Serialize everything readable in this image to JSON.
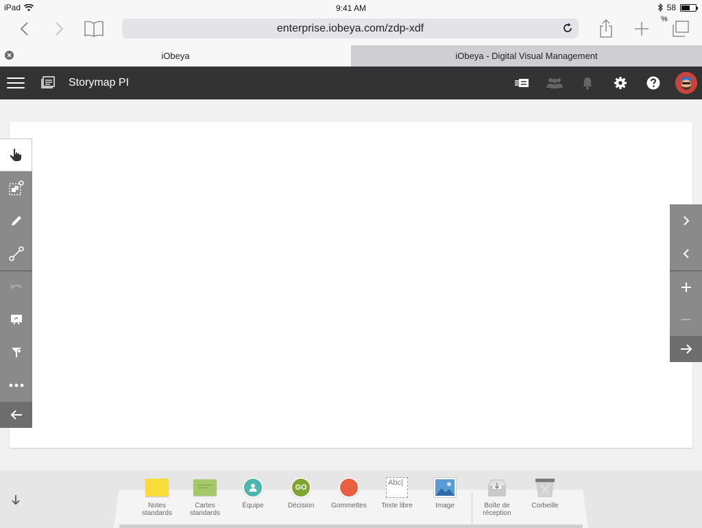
{
  "status_bar": {
    "device": "iPad",
    "time": "9:41 AM",
    "battery": "58",
    "battery_unit": "%",
    "battery_level": 0.58
  },
  "browser": {
    "url": "enterprise.iobeya.com/zdp-xdf"
  },
  "tabs": [
    {
      "label": "iObeya",
      "active": true
    },
    {
      "label": "iObeya - Digital Visual Management",
      "active": false
    }
  ],
  "app": {
    "room_title": "Storymap PI"
  },
  "palette": {
    "items": [
      {
        "label_line1": "Notes",
        "label_line2": "standards",
        "icon": "sticky-note-icon"
      },
      {
        "label_line1": "Cartes",
        "label_line2": "standards",
        "icon": "card-icon"
      },
      {
        "label_line1": "Équipe",
        "label_line2": "",
        "icon": "team-icon"
      },
      {
        "label_line1": "Décision",
        "label_line2": "",
        "icon": "decision-icon",
        "text": "GO"
      },
      {
        "label_line1": "Gommettes",
        "label_line2": "",
        "icon": "sticker-icon"
      },
      {
        "label_line1": "Texte libre",
        "label_line2": "",
        "icon": "free-text-icon",
        "text": "Abc|"
      },
      {
        "label_line1": "Image",
        "label_line2": "",
        "icon": "image-icon"
      },
      {
        "label_line1": "Boîte de",
        "label_line2": "réception",
        "icon": "inbox-icon"
      },
      {
        "label_line1": "Corbeille",
        "label_line2": "",
        "icon": "trash-icon"
      }
    ]
  },
  "colors": {
    "header_bg": "#333333",
    "toolbar_gray": "#8a8a8a",
    "note_yellow": "#f7dc3a",
    "card_green": "#a6c86a",
    "team_teal": "#4db6ac",
    "decision_green": "#7ea631",
    "sticker_orange": "#e8603f"
  }
}
